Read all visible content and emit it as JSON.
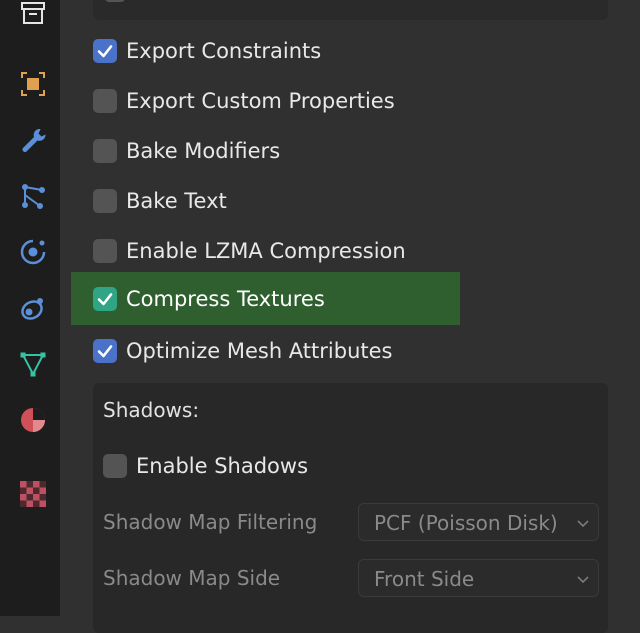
{
  "sidebar": {
    "icons": [
      {
        "name": "archive-icon",
        "color": "#e6e6e6"
      },
      {
        "name": "object-icon",
        "color": "#e0a050"
      },
      {
        "name": "wrench-icon",
        "color": "#5b8fd8"
      },
      {
        "name": "particles-icon",
        "color": "#5b8fd8"
      },
      {
        "name": "physics-icon",
        "color": "#5b8fd8"
      },
      {
        "name": "constraints-icon",
        "color": "#5b8fd8"
      },
      {
        "name": "mesh-data-icon",
        "color": "#35c2a5"
      },
      {
        "name": "material-icon",
        "color": "#d0505a"
      },
      {
        "name": "texture-icon",
        "color": "#c05060"
      }
    ]
  },
  "options": [
    {
      "label": "Export Constraints",
      "checked": true
    },
    {
      "label": "Export Custom Properties",
      "checked": false
    },
    {
      "label": "Bake Modifiers",
      "checked": false
    },
    {
      "label": "Bake Text",
      "checked": false
    },
    {
      "label": "Enable LZMA Compression",
      "checked": false
    },
    {
      "label": "Compress Textures",
      "checked": true,
      "highlighted": true
    },
    {
      "label": "Optimize Mesh Attributes",
      "checked": true
    }
  ],
  "shadows": {
    "title": "Shadows:",
    "enable_label": "Enable Shadows",
    "enable_checked": false,
    "filtering_label": "Shadow Map Filtering",
    "filtering_value": "PCF (Poisson Disk)",
    "side_label": "Shadow Map Side",
    "side_value": "Front Side"
  },
  "colors": {
    "accent_blue": "#4a72c9",
    "highlight_green": "#2f5f2f",
    "teal_check": "#2fa585"
  }
}
